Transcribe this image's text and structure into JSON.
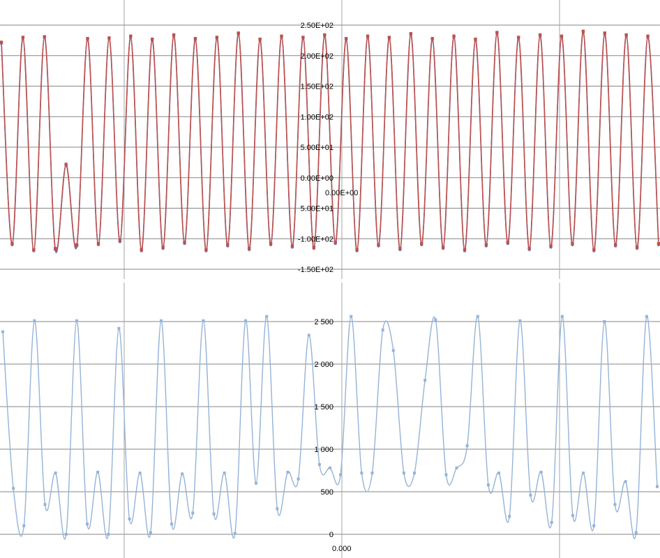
{
  "chart_data": [
    {
      "type": "scatter",
      "ylim": [
        -150,
        250
      ],
      "ytick_labels": [
        "-1.50E+02",
        "-1.00E+02",
        "5.00E+01",
        "0.00E+00",
        "5.00E+01",
        "1.00E+02",
        "1.50E+02",
        "2.00E+02",
        "2.50E+02"
      ],
      "xtick_labels": [
        "0.00E+00"
      ],
      "grid": true,
      "legend": "none",
      "colors": [
        "#4f81bd",
        "#c0504d"
      ],
      "series": [
        {
          "values": [
            220,
            -110,
            228,
            -120,
            230,
            -118,
            20,
            -112,
            226,
            -110,
            228,
            -105,
            230,
            -120,
            225,
            -116,
            232,
            -108,
            226,
            -120,
            228,
            -112,
            235,
            -118,
            225,
            -110,
            230,
            -114,
            228,
            -116,
            232,
            -108,
            226,
            -120,
            230,
            -112,
            228,
            -118,
            234,
            -110,
            226,
            -116,
            230,
            -120,
            225,
            -112,
            236,
            -108,
            228,
            -118,
            232,
            -114,
            230,
            -110,
            238,
            -120,
            235,
            -112,
            232,
            -116,
            230,
            -110
          ]
        },
        {
          "values": [
            222,
            -108,
            230,
            -118,
            231,
            -116,
            22,
            -110,
            228,
            -108,
            229,
            -103,
            232,
            -118,
            227,
            -114,
            234,
            -106,
            228,
            -118,
            230,
            -110,
            237,
            -116,
            227,
            -108,
            232,
            -112,
            230,
            -114,
            234,
            -106,
            228,
            -118,
            232,
            -110,
            230,
            -116,
            236,
            -108,
            228,
            -114,
            232,
            -118,
            227,
            -110,
            238,
            -106,
            230,
            -116,
            234,
            -112,
            232,
            -108,
            240,
            -118,
            237,
            -110,
            234,
            -114,
            232,
            -108
          ]
        }
      ]
    },
    {
      "type": "line",
      "ylim": [
        0,
        2500
      ],
      "ytick_labels": [
        "0",
        "500",
        "1 000",
        "1 500",
        "2 000",
        "2 500"
      ],
      "xtick_labels": [
        "0.000"
      ],
      "grid": true,
      "legend": "none",
      "colors": [
        "#95b3d7"
      ],
      "series": [
        {
          "values": [
            2380,
            540,
            100,
            2510,
            350,
            720,
            0,
            2510,
            120,
            730,
            0,
            2420,
            180,
            720,
            20,
            2510,
            120,
            710,
            250,
            2510,
            240,
            720,
            10,
            2510,
            600,
            2560,
            300,
            730,
            650,
            2340,
            820,
            780,
            700,
            2560,
            720,
            720,
            2400,
            2160,
            720,
            720,
            1810,
            2520,
            700,
            780,
            1040,
            2560,
            580,
            720,
            210,
            2510,
            460,
            730,
            140,
            2560,
            220,
            720,
            100,
            2500,
            350,
            620,
            20,
            2560,
            560
          ]
        }
      ]
    }
  ]
}
